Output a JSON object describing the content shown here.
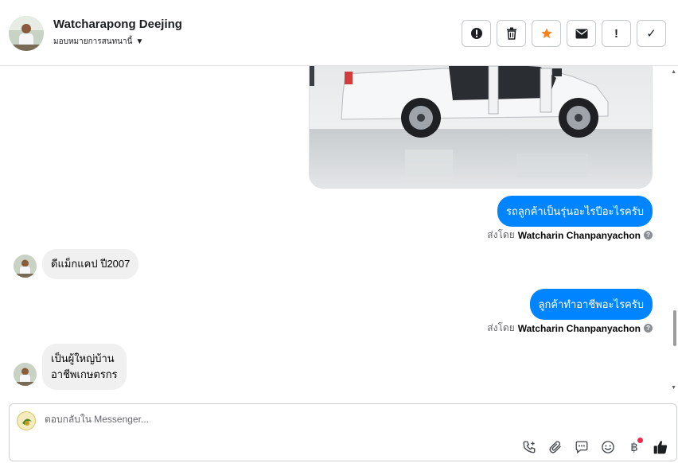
{
  "header": {
    "contact_name": "Watcharapong Deejing",
    "assign_label": "มอบหมายการสนทนานี้",
    "toolbar": [
      {
        "name": "report-button",
        "icon": "alert-circle-icon",
        "glyph": "!"
      },
      {
        "name": "delete-button",
        "icon": "trash-icon",
        "glyph": ""
      },
      {
        "name": "star-button",
        "icon": "star-icon",
        "glyph": "★"
      },
      {
        "name": "mail-button",
        "icon": "envelope-icon",
        "glyph": ""
      },
      {
        "name": "important-button",
        "icon": "exclamation-icon",
        "glyph": "!"
      },
      {
        "name": "done-button",
        "icon": "checkmark-icon",
        "glyph": "✓"
      }
    ]
  },
  "messages": {
    "m1": "รถลูกค้าเป็นรุ่นอะไรปีอะไรครับ",
    "m1_sent_prefix": "ส่งโดย",
    "m1_sender": "Watcharin Chanpanyachon",
    "m2": "ดีแม็กแคป ปี2007",
    "m3": "ลูกค้าทำอาชีพอะไรครับ",
    "m3_sent_prefix": "ส่งโดย",
    "m3_sender": "Watcharin Chanpanyachon",
    "m4_line1": "เป็นผู้ใหญ่บ้าน",
    "m4_line2": "อาชีพเกษตรกร"
  },
  "reply": {
    "placeholder": "ตอบกลับใน Messenger..."
  },
  "colors": {
    "accent": "#0084ff",
    "star": "#f5821f",
    "notification": "#f02849"
  }
}
